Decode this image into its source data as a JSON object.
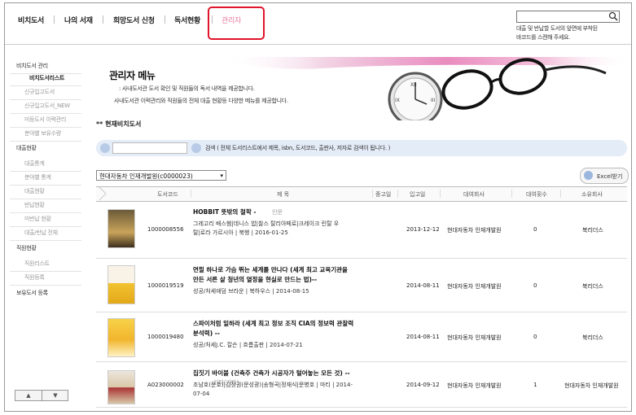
{
  "nav": {
    "items": [
      "비치도서",
      "나의 서재",
      "희망도서 신청",
      "독서현황",
      "관리자"
    ],
    "scan_hint_line1": "대출 및 반납할 도서의 앞면에 부착된",
    "scan_hint_line2": "바코드를 스캔해 주세요."
  },
  "sidebar": {
    "items": [
      {
        "label": "비치도서 관리",
        "kind": "head"
      },
      {
        "label": "비치도서리스트",
        "kind": "active"
      },
      {
        "label": "신규입고도서",
        "kind": "sub"
      },
      {
        "label": "신규입고도서_NEW",
        "kind": "sub"
      },
      {
        "label": "미등도서 이력관리",
        "kind": "sub"
      },
      {
        "label": "분야별 보유수량",
        "kind": "sub"
      },
      {
        "label": "대출현황",
        "kind": "head"
      },
      {
        "label": "대출통계",
        "kind": "sub"
      },
      {
        "label": "분야별 통계",
        "kind": "sub"
      },
      {
        "label": "대출현황",
        "kind": "sub"
      },
      {
        "label": "반납현황",
        "kind": "sub"
      },
      {
        "label": "미반납 현황",
        "kind": "sub"
      },
      {
        "label": "대출/반납 전체",
        "kind": "sub"
      },
      {
        "label": "직원현황",
        "kind": "head"
      },
      {
        "label": "직원리스트",
        "kind": "sub"
      },
      {
        "label": "직원등록",
        "kind": "sub"
      },
      {
        "label": "보유도서 등록",
        "kind": "head"
      }
    ],
    "pager_up": "▲",
    "pager_down": "▼"
  },
  "banner": {
    "title": "관리자 메뉴",
    "line1": ": 사내도서관 도서 확인 및 직원들의 독서 내역을 제공합니다.",
    "line2": "사내도서관 이력관리와 직원들의 전체 대출 현황등 다양한 메뉴를 제공합니다."
  },
  "section_title": "** 현재비치도서",
  "search": {
    "value": "",
    "hint": "검색 ( 전체 도서리스트에서 제목, isbn, 도서코드, 출판사, 저자로 검색이 됩니다. )"
  },
  "company_select": "현대자동차 인재개발원(c0000023)",
  "excel_label": "Excel받기",
  "table": {
    "headers": [
      "도서코드",
      "제 목",
      "중고일",
      "입고일",
      "대여회사",
      "대여횟수",
      "소유회사"
    ],
    "rows": [
      {
        "code": "1000008556",
        "title_lines": [
          "HOBBIT 뜻밖의 철학 -"
        ],
        "title_tag": "인문",
        "sub_lines": [
          "그레고리 배스햄|데니스 밥|찰스 탈리아페로|크레이크 린탈 우",
          "탈|로라 가르시아 | 북행 | 2016-01-25"
        ],
        "in_date": "2013-12-12",
        "rent_company": "현대자동차 인재개발원",
        "rent_count": "0",
        "owner": "북리더스"
      },
      {
        "code": "1000019519",
        "title_lines": [
          "연필 하나로 가슴 뛰는 세계를 만나다 (세계 최고 교육기관을",
          "만든 서른 살 청년의 열정을 현실로 만드는 법)--"
        ],
        "title_tag": "",
        "sub_lines": [
          "성공/처세애덤 브라운 | 북하우스 | 2014-08-15"
        ],
        "in_date": "2014-08-11",
        "rent_company": "현대자동차 인재개발원",
        "rent_count": "0",
        "owner": "북리더스"
      },
      {
        "code": "1000019480",
        "title_lines": [
          "스파이처럼 일하라 (세계 최고 정보 조직 CIA의 정보력 관찰력",
          "분석력) --"
        ],
        "title_tag": "",
        "sub_lines": [
          "성공/처세J.C. 칼슨 | 흐름출판 | 2014-07-21"
        ],
        "in_date": "2014-08-11",
        "rent_company": "현대자동차 인재개발원",
        "rent_count": "0",
        "owner": "북리더스"
      },
      {
        "code": "A023000002",
        "title_lines": [
          "집짓기 바이블 (건축주 건축가 시공자가 털어놓는 모든 것) --"
        ],
        "title_tag": "기타(기타)",
        "sub_lines": [
          "조남호(문호)|김장권(문성광)|송형곡|정재식|문병호 | 마티 | 2014-",
          "07-04"
        ],
        "in_date": "2014-09-12",
        "rent_company": "현대자동차 인재개발원",
        "rent_count": "1",
        "owner": "현대자동차 인재개발원"
      }
    ]
  }
}
